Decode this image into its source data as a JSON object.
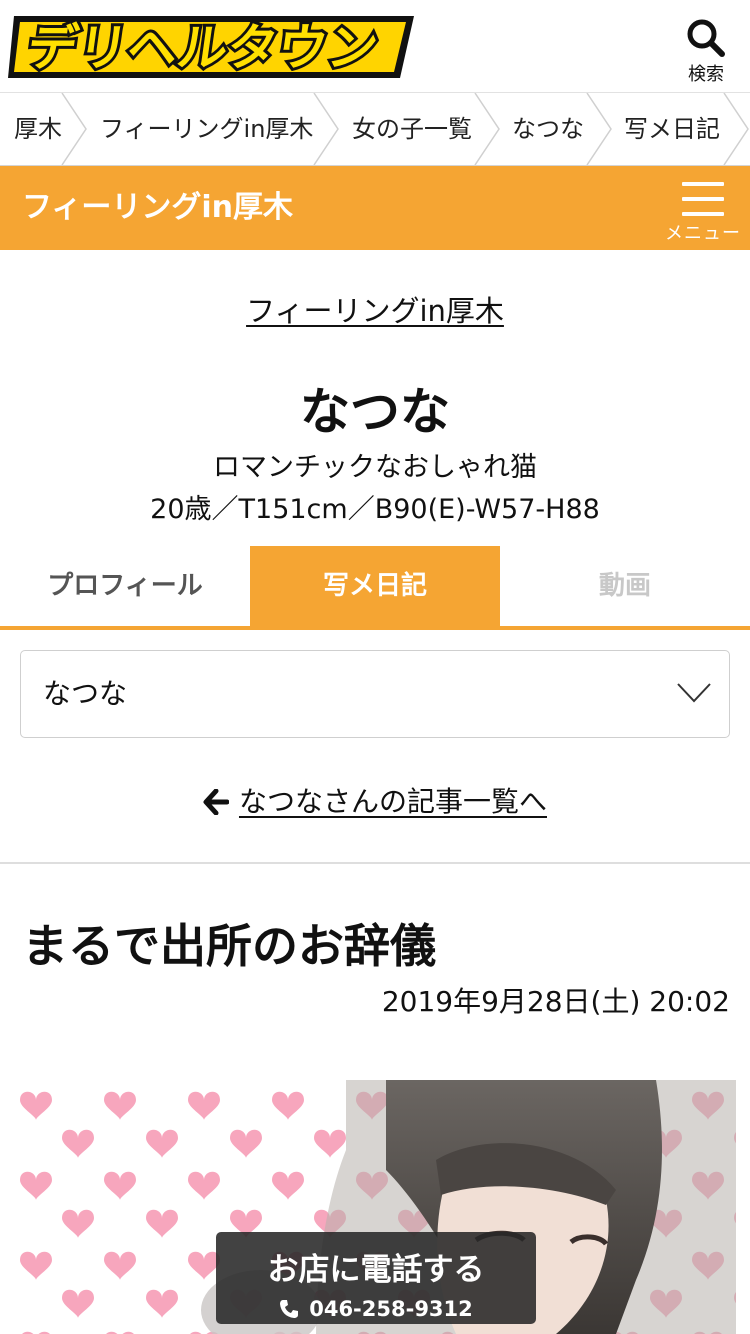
{
  "header": {
    "logo_text": "デリヘルタウン",
    "search_label": "検索"
  },
  "breadcrumb": {
    "items": [
      "厚木",
      "フィーリングin厚木",
      "女の子一覧",
      "なつな",
      "写メ日記"
    ]
  },
  "shop_bar": {
    "title": "フィーリングin厚木",
    "menu_label": "メニュー"
  },
  "profile": {
    "shop_link": "フィーリングin厚木",
    "name": "なつな",
    "catch_copy": "ロマンチックなおしゃれ猫",
    "specs": "20歳／T151cm／B90(E)-W57-H88"
  },
  "tabs": [
    "プロフィール",
    "写メ日記",
    "動画"
  ],
  "filter_select": {
    "selected": "なつな"
  },
  "back_link": "なつなさんの記事一覧へ",
  "article": {
    "title": "まるで出所のお辞儀",
    "date": "2019年9月28日(土) 20:02"
  },
  "call_button": {
    "title": "お店に電話する",
    "number": "046-258-9312"
  },
  "colors": {
    "accent": "#f5a533",
    "logo_yellow": "#ffd400",
    "heart_pink": "#f7a6bd"
  }
}
